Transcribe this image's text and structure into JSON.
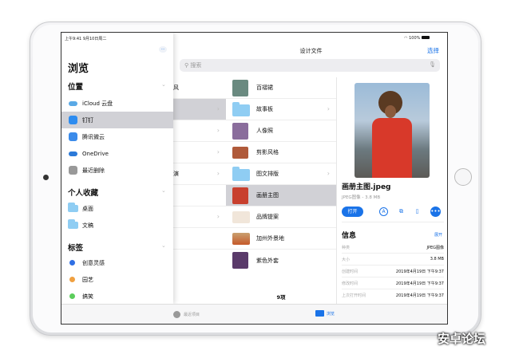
{
  "status": {
    "time_date": "上午9:41  9月10日周二",
    "battery": "100%"
  },
  "sidebar": {
    "title": "浏览",
    "more_icon": "ellipsis-icon",
    "locations_header": "位置",
    "locations": [
      {
        "label": "iCloud 云盘",
        "color": "#5aa9e6"
      },
      {
        "label": "钉钉",
        "color": "#2d8cf0"
      },
      {
        "label": "腾讯微云",
        "color": "#3b8bea"
      },
      {
        "label": "OneDrive",
        "color": "#2b79d8"
      },
      {
        "label": "最近删除",
        "color": "#999999"
      }
    ],
    "favorites_header": "个人收藏",
    "favorites": [
      {
        "label": "桌面"
      },
      {
        "label": "文稿"
      }
    ],
    "tags_header": "标签",
    "tags": [
      {
        "label": "创意灵感",
        "color": "#2f6fe4"
      },
      {
        "label": "园艺",
        "color": "#f0a040"
      },
      {
        "label": "搞笑",
        "color": "#5ccd5c"
      }
    ]
  },
  "header": {
    "title": "设计文件",
    "select": "选择",
    "search_placeholder": "搜索"
  },
  "col1": {
    "items": [
      "风",
      "",
      "",
      "",
      "演",
      "",
      "",
      ""
    ]
  },
  "files": {
    "items": [
      {
        "name": "百褶裙",
        "type": "image",
        "color": "#6a8a80"
      },
      {
        "name": "故事板",
        "type": "folder"
      },
      {
        "name": "人像照",
        "type": "image",
        "color": "#8a6d9c"
      },
      {
        "name": "剪影风格",
        "type": "image",
        "color": "#b05a3a"
      },
      {
        "name": "图文排版",
        "type": "folder"
      },
      {
        "name": "画册主图",
        "type": "image",
        "color": "#c8402e"
      },
      {
        "name": "品牌提案",
        "type": "image",
        "color": "#f1e6da"
      },
      {
        "name": "加州外景地",
        "type": "image",
        "color": "#c57a3a"
      },
      {
        "name": "紫色外套",
        "type": "image",
        "color": "#5a3a6a"
      }
    ],
    "count": "9项"
  },
  "detail": {
    "filename": "画册主图.jpeg",
    "meta": "JPEG图像 - 3.8 MB",
    "open": "打开",
    "info_title": "信息",
    "expand": "展开",
    "info": [
      {
        "k": "种类",
        "v": "JPEG图像"
      },
      {
        "k": "大小",
        "v": "3.8 MB"
      },
      {
        "k": "创建时间",
        "v": "2019年4月19日 下午9:37"
      },
      {
        "k": "修改时间",
        "v": "2019年4月19日 下午9:37"
      },
      {
        "k": "上次打开时间",
        "v": "2019年4月19日 下午9:37"
      }
    ]
  },
  "tabbar": {
    "recents": "最近项目",
    "browse": "浏览"
  },
  "watermark": "安卓论坛"
}
